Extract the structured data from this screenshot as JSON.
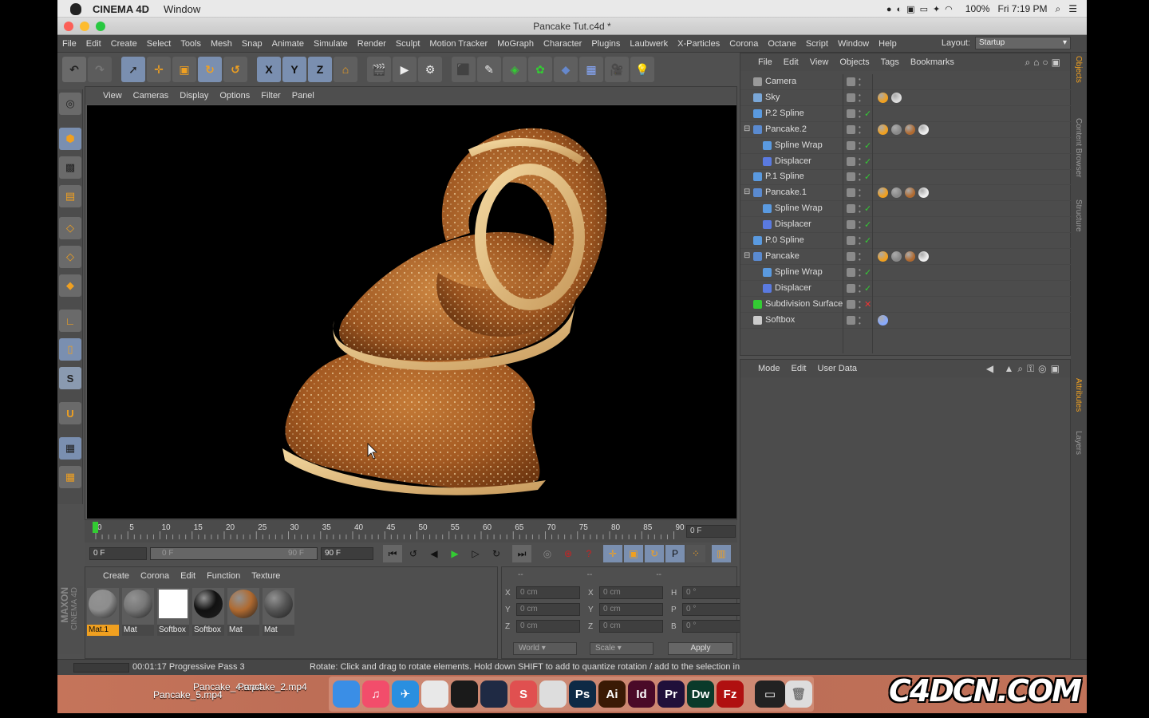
{
  "mac_menubar": {
    "app_name": "CINEMA 4D",
    "menu": "Window",
    "battery": "100%",
    "clock": "Fri 7:19 PM"
  },
  "window": {
    "title": "Pancake Tut.c4d *"
  },
  "menus": [
    "File",
    "Edit",
    "Create",
    "Select",
    "Tools",
    "Mesh",
    "Snap",
    "Animate",
    "Simulate",
    "Render",
    "Sculpt",
    "Motion Tracker",
    "MoGraph",
    "Character",
    "Plugins",
    "Laubwerk",
    "X-Particles",
    "Corona",
    "Octane",
    "Script",
    "Window",
    "Help"
  ],
  "layout": {
    "label": "Layout:",
    "value": "Startup"
  },
  "toolbar": {
    "x": "X",
    "y": "Y",
    "z": "Z"
  },
  "viewport_menu": [
    "View",
    "Cameras",
    "Display",
    "Options",
    "Filter",
    "Panel"
  ],
  "timeline": {
    "ticks": [
      "0",
      "5",
      "10",
      "15",
      "20",
      "25",
      "30",
      "35",
      "40",
      "45",
      "50",
      "55",
      "60",
      "65",
      "70",
      "75",
      "80",
      "85",
      "90"
    ],
    "current_frame": "0 F"
  },
  "transport": {
    "start": "0 F",
    "range_start": "0 F",
    "range_end": "90 F",
    "end": "90 F"
  },
  "material_menu": [
    "Create",
    "Corona",
    "Edit",
    "Function",
    "Texture"
  ],
  "materials": [
    {
      "name": "Mat.1",
      "color": "#8d8d8d",
      "selected": true
    },
    {
      "name": "Mat",
      "color": "#777777",
      "selected": false
    },
    {
      "name": "Softbox",
      "color": "#ffffff",
      "selected": false
    },
    {
      "name": "Softbox",
      "color": "#111111",
      "selected": false
    },
    {
      "name": "Mat",
      "color": "#b06a30",
      "selected": false
    },
    {
      "name": "Mat",
      "color": "#555555",
      "selected": false
    }
  ],
  "coordinates": {
    "header": [
      "--",
      "--",
      "--"
    ],
    "rows": [
      {
        "a": "X",
        "av": "0 cm",
        "b": "X",
        "bv": "0 cm",
        "c": "H",
        "cv": "0 °"
      },
      {
        "a": "Y",
        "av": "0 cm",
        "b": "Y",
        "bv": "0 cm",
        "c": "P",
        "cv": "0 °"
      },
      {
        "a": "Z",
        "av": "0 cm",
        "b": "Z",
        "bv": "0 cm",
        "c": "B",
        "cv": "0 °"
      }
    ],
    "mode": "World",
    "scale": "Scale",
    "apply": "Apply"
  },
  "status": {
    "time": "00:01:17 Progressive Pass 3",
    "hint": "Rotate: Click and drag to rotate elements. Hold down SHIFT to add to quantize rotation / add to the selection in"
  },
  "object_manager": {
    "menu": [
      "File",
      "Edit",
      "View",
      "Objects",
      "Tags",
      "Bookmarks"
    ],
    "objects": [
      {
        "name": "Camera",
        "indent": 0
      },
      {
        "name": "Sky",
        "indent": 0
      },
      {
        "name": "P.2 Spline",
        "indent": 0
      },
      {
        "name": "Pancake.2",
        "indent": 0
      },
      {
        "name": "Spline Wrap",
        "indent": 1
      },
      {
        "name": "Displacer",
        "indent": 1
      },
      {
        "name": "P.1 Spline",
        "indent": 0
      },
      {
        "name": "Pancake.1",
        "indent": 0
      },
      {
        "name": "Spline Wrap",
        "indent": 1
      },
      {
        "name": "Displacer",
        "indent": 1
      },
      {
        "name": "P.0 Spline",
        "indent": 0
      },
      {
        "name": "Pancake",
        "indent": 0
      },
      {
        "name": "Spline Wrap",
        "indent": 1
      },
      {
        "name": "Displacer",
        "indent": 1
      },
      {
        "name": "Subdivision Surface",
        "indent": 0
      },
      {
        "name": "Softbox",
        "indent": 0
      }
    ]
  },
  "attribute_manager": {
    "menu": [
      "Mode",
      "Edit",
      "User Data"
    ]
  },
  "side_tabs": [
    "Objects",
    "Content Browser",
    "Structure",
    "Attributes",
    "Layers"
  ],
  "branding": {
    "maxon": "MAXON",
    "cinema": "CINEMA 4D"
  },
  "dock": {
    "files": [
      "Pancake_5.mp4",
      "Pancake_4.mp4",
      "Pancake_2.mp4"
    ],
    "apps": [
      {
        "label": "",
        "color": "#3a8ee6"
      },
      {
        "label": "♫",
        "color": "#f24d6b"
      },
      {
        "label": "✈",
        "color": "#2a8fe0"
      },
      {
        "label": "",
        "color": "#e8e8e8"
      },
      {
        "label": "",
        "color": "#1a1a1a"
      },
      {
        "label": "",
        "color": "#1f2a44"
      },
      {
        "label": "S",
        "color": "#e05050"
      },
      {
        "label": "",
        "color": "#dddddd"
      },
      {
        "label": "Ps",
        "color": "#0e2a45"
      },
      {
        "label": "Ai",
        "color": "#3a1a05"
      },
      {
        "label": "Id",
        "color": "#4a0a28"
      },
      {
        "label": "Pr",
        "color": "#20103a"
      },
      {
        "label": "Dw",
        "color": "#0a3a2a"
      },
      {
        "label": "Fz",
        "color": "#b01010"
      }
    ]
  },
  "watermark": "C4DCN.COM"
}
